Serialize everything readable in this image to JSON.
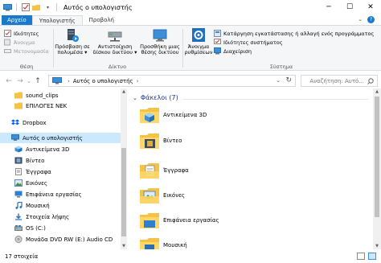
{
  "window": {
    "title": "Αυτός ο υπολογιστής",
    "minimize_glyph": "─",
    "maximize_glyph": "☐",
    "close_glyph": "✕"
  },
  "tabs": [
    {
      "label": "Αρχείο",
      "kind": "file"
    },
    {
      "label": "Υπολογιστής",
      "kind": "active"
    },
    {
      "label": "Προβολή",
      "kind": "normal"
    }
  ],
  "ribbon": {
    "location_group": {
      "label": "Θέση",
      "items": [
        {
          "label": "Ιδιότητες",
          "enabled": true
        },
        {
          "label": "Άνοιγμα",
          "enabled": false
        },
        {
          "label": "Μετονομασία",
          "enabled": false
        }
      ]
    },
    "network_group": {
      "label": "Δίκτυο",
      "buttons": [
        {
          "label_line1": "Πρόσβαση σε",
          "label_line2": "πολυμέσα ▾"
        },
        {
          "label_line1": "Αντιστοίχιση",
          "label_line2": "δίσκου δικτύου ▾"
        },
        {
          "label_line1": "Προσθήκη μιας",
          "label_line2": "θέσης δικτύου"
        }
      ]
    },
    "system_group": {
      "label": "Σύστημα",
      "big_button": {
        "label_line1": "Άνοιγμα",
        "label_line2": "ρυθμίσεων"
      },
      "items": [
        {
          "label": "Κατάργηση εγκατάστασης ή αλλαγή ενός προγράμματος"
        },
        {
          "label": "Ιδιότητες συστήματος"
        },
        {
          "label": "Διαχείριση"
        }
      ]
    }
  },
  "navigation": {
    "back": "←",
    "forward": "→",
    "recent": "⌄",
    "up": "↑",
    "address_path": "Αυτός ο υπολογιστής",
    "address_chevron": "›",
    "dropdown_glyph": "⌄",
    "refresh_glyph": "↻",
    "search_placeholder": "Αναζήτηση: Αυτό..."
  },
  "nav_pane": {
    "items": [
      {
        "label": "sound_clips",
        "icon": "folder",
        "indent": 1
      },
      {
        "label": "ΕΠΙΛΟΓΕΣ ΝΕΚ",
        "icon": "folder",
        "indent": 1
      },
      {
        "label": "Dropbox",
        "icon": "dropbox",
        "indent": 0
      },
      {
        "label": "Αυτός ο υπολογιστής",
        "icon": "computer",
        "indent": 0,
        "selected": true
      },
      {
        "label": "Αντικείμενα 3D",
        "icon": "objects-3d",
        "indent": 1
      },
      {
        "label": "Βίντεο",
        "icon": "video",
        "indent": 1
      },
      {
        "label": "Έγγραφα",
        "icon": "documents",
        "indent": 1
      },
      {
        "label": "Εικόνες",
        "icon": "pictures",
        "indent": 1
      },
      {
        "label": "Επιφάνεια εργασίας",
        "icon": "desktop",
        "indent": 1
      },
      {
        "label": "Μουσική",
        "icon": "music",
        "indent": 1
      },
      {
        "label": "Στοιχεία λήψης",
        "icon": "downloads",
        "indent": 1
      },
      {
        "label": "OS (C:)",
        "icon": "drive",
        "indent": 1
      },
      {
        "label": "Μονάδα DVD RW (E:) Audio CD",
        "icon": "dvd",
        "indent": 1
      }
    ]
  },
  "content": {
    "group_title": "Φάκελοι (7)",
    "folders": [
      {
        "label": "Αντικείμενα 3D",
        "icon": "objects-3d"
      },
      {
        "label": "Βίντεο",
        "icon": "video"
      },
      {
        "label": "Έγγραφα",
        "icon": "documents"
      },
      {
        "label": "Εικόνες",
        "icon": "pictures"
      },
      {
        "label": "Επιφάνεια εργασίας",
        "icon": "desktop"
      },
      {
        "label": "Μουσική",
        "icon": "music"
      }
    ]
  },
  "status": {
    "item_count": "17 στοιχεία"
  },
  "colors": {
    "file_tab": "#1979ca",
    "selection": "#cce8ff",
    "folder_yellow": "#f6c243",
    "group_header": "#1e3287"
  }
}
